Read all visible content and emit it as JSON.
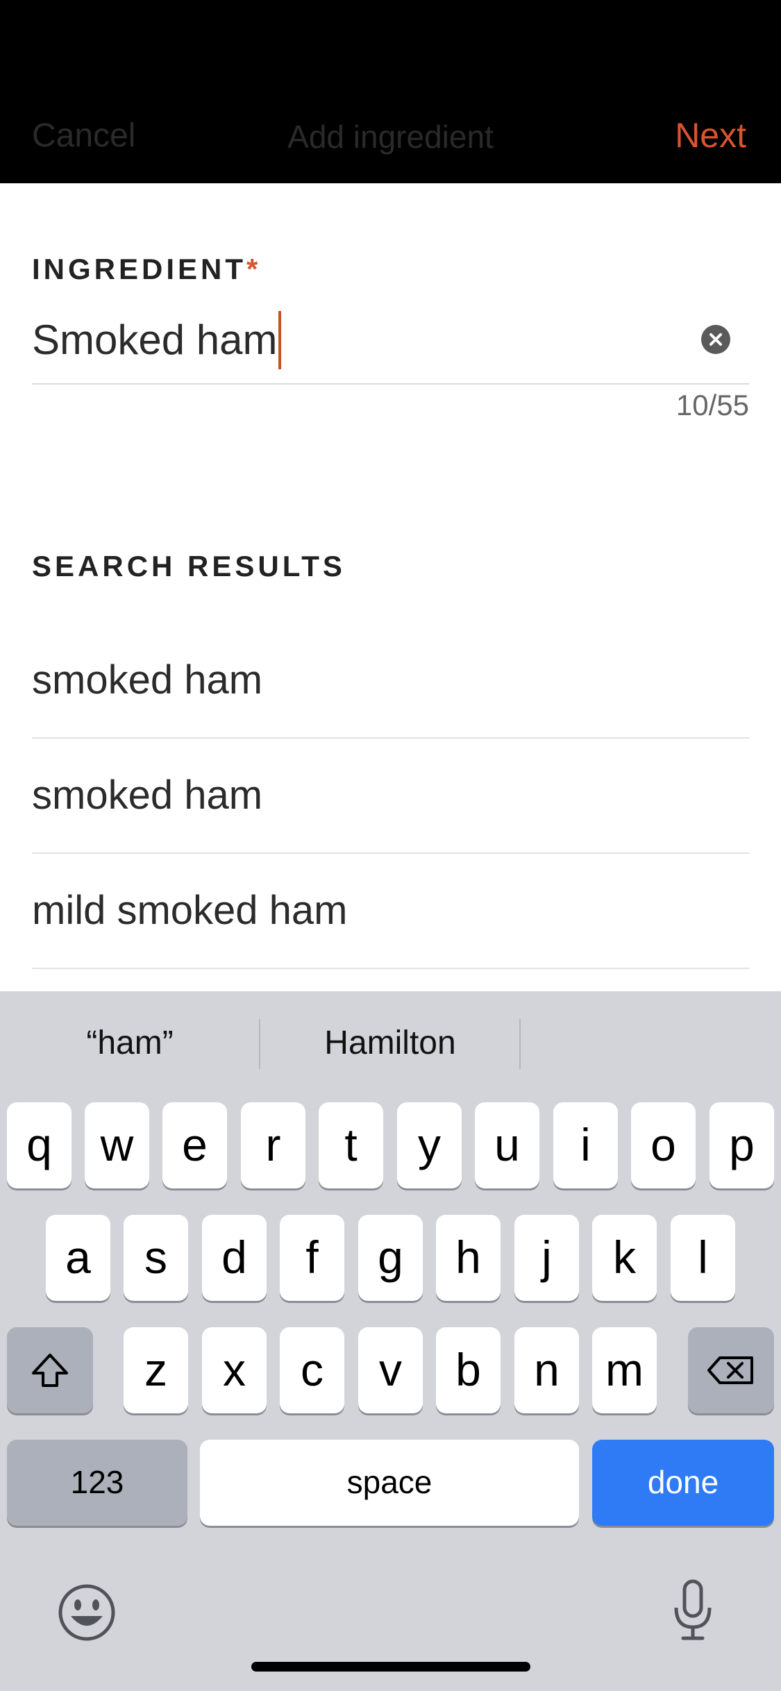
{
  "nav": {
    "cancel_label": "Cancel",
    "title": "Add ingredient",
    "next_label": "Next"
  },
  "ingredient": {
    "label": "INGREDIENT",
    "required_mark": "*",
    "value": "Smoked ham",
    "counter": "10/55"
  },
  "results": {
    "label": "SEARCH RESULTS",
    "items": [
      "smoked ham",
      "smoked ham",
      "mild smoked ham"
    ]
  },
  "keyboard": {
    "suggestions": [
      "“ham”",
      "Hamilton",
      ""
    ],
    "row1": [
      "q",
      "w",
      "e",
      "r",
      "t",
      "y",
      "u",
      "i",
      "o",
      "p"
    ],
    "row2": [
      "a",
      "s",
      "d",
      "f",
      "g",
      "h",
      "j",
      "k",
      "l"
    ],
    "row3": [
      "z",
      "x",
      "c",
      "v",
      "b",
      "n",
      "m"
    ],
    "numbers_label": "123",
    "space_label": "space",
    "done_label": "done"
  },
  "colors": {
    "accent": "#d9542e",
    "done_blue": "#2f7bf6",
    "keyboard_bg": "#d2d4da"
  }
}
